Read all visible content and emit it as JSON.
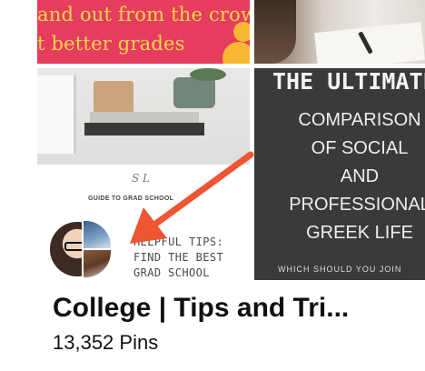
{
  "board": {
    "title": "College | Tips and Tri...",
    "pin_count": "13,352 Pins"
  },
  "cover": {
    "pink_tile": {
      "line1": "and out from the crowd",
      "line2": "t better grades"
    },
    "grad_tile": {
      "monogram": "S  L",
      "guide": "GUIDE TO GRAD SCHOOL",
      "tips": "HELPFUL TIPS:\nFIND THE BEST\nGRAD SCHOOL"
    },
    "dark_tile": {
      "heading": "THE ULTIMATE",
      "body": "COMPARISON\nOF SOCIAL\nAND\nPROFESSIONAL\nGREEK LIFE",
      "footer": "WHICH SHOULD YOU JOIN"
    }
  },
  "colors": {
    "arrow": "#ee5533",
    "pink": "#e63c5e",
    "yellow_text": "#f6d64a"
  },
  "icons": {
    "annotation": "arrow-pointer"
  }
}
